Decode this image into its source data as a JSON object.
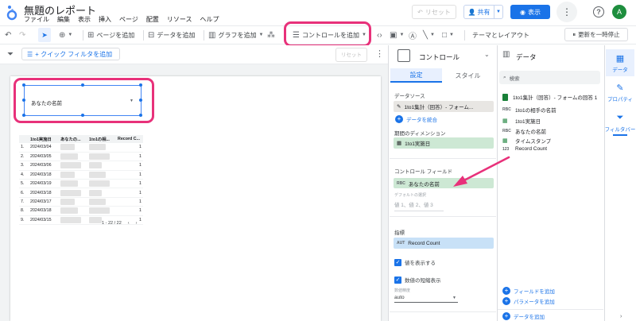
{
  "header": {
    "title": "無題のレポート",
    "menus": [
      "ファイル",
      "編集",
      "表示",
      "挿入",
      "ページ",
      "配置",
      "リソース",
      "ヘルプ"
    ],
    "reset_label": "リセット",
    "share_label": "共有",
    "view_label": "表示",
    "avatar_initial": "A"
  },
  "toolbar": {
    "add_page": "ページを追加",
    "add_data": "データを追加",
    "add_chart": "グラフを追加",
    "add_control": "コントロールを追加",
    "theme_layout": "テーマとレイアウト",
    "pause_updates": "更新を一時停止"
  },
  "filterbar": {
    "quick_filter": "+ クイック フィルタを追加",
    "reset": "リセット"
  },
  "canvas": {
    "control_placeholder": "あなたの名前",
    "table": {
      "columns": [
        "",
        "1to1実施日",
        "あなたの...",
        "1to1の相...",
        "Record C..."
      ],
      "rows": [
        {
          "n": "1.",
          "date": "2024/03/04",
          "count": "1"
        },
        {
          "n": "2.",
          "date": "2024/03/05",
          "count": "1"
        },
        {
          "n": "3.",
          "date": "2024/03/06",
          "count": "1"
        },
        {
          "n": "4.",
          "date": "2024/03/18",
          "count": "1"
        },
        {
          "n": "5.",
          "date": "2024/03/19",
          "count": "1"
        },
        {
          "n": "6.",
          "date": "2024/03/18",
          "count": "1"
        },
        {
          "n": "7.",
          "date": "2024/03/17",
          "count": "1"
        },
        {
          "n": "8.",
          "date": "2024/03/18",
          "count": "1"
        },
        {
          "n": "9.",
          "date": "2024/03/15",
          "count": "1"
        }
      ],
      "pager": "1 - 22 / 22"
    }
  },
  "props": {
    "title": "コントロール",
    "tab_setup": "設定",
    "tab_style": "スタイル",
    "data_source_label": "データソース",
    "data_source_value": "1to1集計（回答）- フォーム...",
    "blend_link": "データを統合",
    "period_dim_label": "期間のディメンション",
    "period_dim_value": "1to1実施日",
    "control_field_label": "コントロール フィールド",
    "control_field_value": "あなたの名前",
    "default_selection_label": "デフォルトの選択",
    "default_selection_placeholder": "値 1、値 2、値 3",
    "metric_label": "指標",
    "metric_value": "Record Count",
    "metric_tag": "AUT",
    "show_values": "値を表示する",
    "compact_numbers": "数値の短縮表示",
    "decimal_label": "数値精度",
    "decimal_value": "auto"
  },
  "data_panel": {
    "title": "データ",
    "search_placeholder": "検索",
    "source_name": "1to1集計（回答）- フォームの回答 1",
    "fields": [
      {
        "tag": "RBC",
        "name": "1to1の相手の名前"
      },
      {
        "tag": "",
        "name": "1to1実施日"
      },
      {
        "tag": "RBC",
        "name": "あなたの名前"
      },
      {
        "tag": "",
        "name": "タイムスタンプ"
      },
      {
        "tag": "123",
        "name": "Record Count"
      }
    ],
    "add_field": "フィールドを追加",
    "add_param": "パラメータを追加",
    "add_data": "データを追加"
  },
  "rail": {
    "data": "データ",
    "props": "プロパティ",
    "filter": "フィルタバー"
  },
  "colors": {
    "accent": "#1a73e8",
    "highlight": "#e8317a"
  }
}
